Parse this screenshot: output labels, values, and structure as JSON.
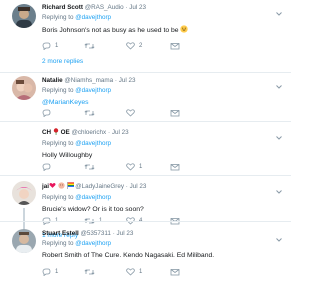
{
  "tweets": [
    {
      "name": "Richard Scott",
      "handle": "@RAS_Audio",
      "date": "· Jul 23",
      "replying_prefix": "Replying to ",
      "replying_to": "@davejthorp",
      "text": "Boris Johnson's not as busy as he used to be",
      "replies": "1",
      "retweets": "",
      "likes": "2",
      "more_link": "2 more replies"
    },
    {
      "name": "Natalie",
      "handle": "@Niamhs_mama",
      "date": "· Jul 23",
      "replying_prefix": "Replying to ",
      "replying_to": "@davejthorp",
      "mention_line": "@MarianKeyes",
      "replies": "",
      "retweets": "",
      "likes": ""
    },
    {
      "name": "CH",
      "name_suffix": "OE",
      "handle": "@chloerichx",
      "date": "· Jul 23",
      "replying_prefix": "Replying to ",
      "replying_to": "@davejthorp",
      "text": "Holly Willoughby",
      "replies": "",
      "retweets": "",
      "likes": "1"
    },
    {
      "name": "jai",
      "handle": "@LadyJaineGrey",
      "date": "· Jul 23",
      "replying_prefix": "Replying to ",
      "replying_to": "@davejthorp",
      "text": "Brucie's widow? Or is it too soon?",
      "replies": "1",
      "retweets": "1",
      "likes": "4",
      "more_link": "1 more reply"
    },
    {
      "name": "Stuart Estell",
      "handle": "@5357311",
      "date": "· Jul 23",
      "replying_prefix": "Replying to ",
      "replying_to": "@davejthorp",
      "text": "Robert Smith of The Cure. Kendo Nagasaki. Ed Miliband.",
      "replies": "1",
      "retweets": "",
      "likes": "1"
    }
  ],
  "icons": {
    "reply": "reply-icon",
    "retweet": "retweet-icon",
    "like": "heart-icon",
    "dm": "envelope-icon",
    "caret": "chevron-down-icon"
  },
  "colors": {
    "link": "#1da1f2",
    "muted": "#657786",
    "separator": "#e6ecf0"
  }
}
